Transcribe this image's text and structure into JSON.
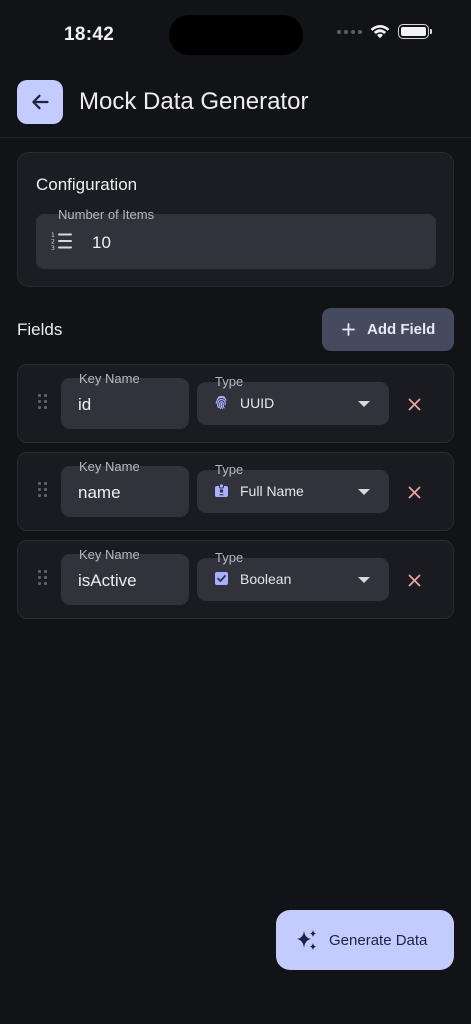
{
  "status_bar": {
    "time": "18:42"
  },
  "header": {
    "title": "Mock Data Generator",
    "back_icon": "arrow-left-icon"
  },
  "configuration": {
    "title": "Configuration",
    "items_label": "Number of Items",
    "items_value": "10",
    "items_icon": "numbered-list-icon"
  },
  "fields": {
    "title": "Fields",
    "add_label": "Add Field",
    "rows": [
      {
        "key_label": "Key Name",
        "key_value": "id",
        "type_label": "Type",
        "type_value": "UUID",
        "type_icon": "fingerprint-icon"
      },
      {
        "key_label": "Key Name",
        "key_value": "name",
        "type_label": "Type",
        "type_value": "Full Name",
        "type_icon": "badge-icon"
      },
      {
        "key_label": "Key Name",
        "key_value": "isActive",
        "type_label": "Type",
        "type_value": "Boolean",
        "type_icon": "checkbox-icon"
      }
    ]
  },
  "generate": {
    "label": "Generate Data",
    "icon": "sparkles-icon"
  },
  "colors": {
    "background": "#121317",
    "card": "#1c1d22",
    "input": "#32333a",
    "accent": "#c4cbff",
    "icon_accent": "#a9b0ff",
    "remove": "#f0a3a3",
    "add_button": "#454a5e"
  }
}
